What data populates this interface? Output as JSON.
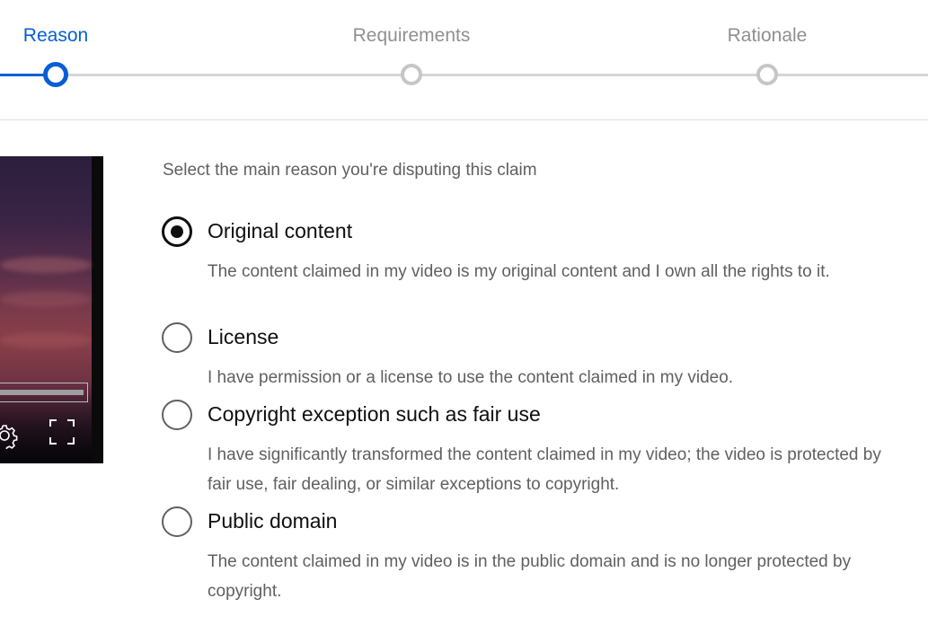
{
  "stepper": {
    "steps": [
      {
        "label": "Reason",
        "state": "active"
      },
      {
        "label": "Requirements",
        "state": "inactive"
      },
      {
        "label": "Rationale",
        "state": "inactive"
      }
    ]
  },
  "video": {
    "progress_fraction": 0.96,
    "controls": {
      "settings_icon": "gear-icon",
      "fullscreen_icon": "fullscreen-icon"
    }
  },
  "form": {
    "prompt": "Select the main reason you're disputing this claim",
    "options": [
      {
        "title": "Original content",
        "description": "The content claimed in my video is my original content and I own all the rights to it.",
        "selected": true
      },
      {
        "title": "License",
        "description": "I have permission or a license to use the content claimed in my video.",
        "selected": false
      },
      {
        "title": "Copyright exception such as fair use",
        "description": "I have significantly transformed the content claimed in my video; the video is protected by fair use, fair dealing, or similar exceptions to copyright.",
        "selected": false
      },
      {
        "title": "Public domain",
        "description": "The content claimed in my video is in the public domain and is no longer protected by copyright.",
        "selected": false
      }
    ]
  },
  "colors": {
    "accent": "#065fd4",
    "inactive": "#c6c6c6",
    "text_primary": "#0f0f0f",
    "text_secondary": "#606060"
  }
}
